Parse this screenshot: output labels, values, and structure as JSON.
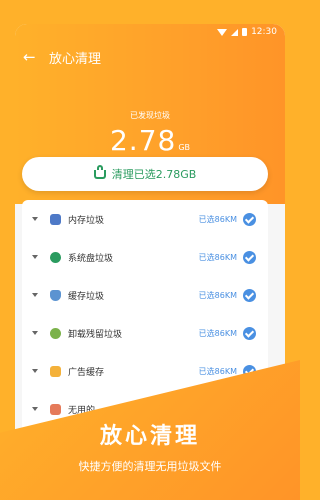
{
  "status": {
    "time": "12:30"
  },
  "header": {
    "back_icon": "arrow-left-icon",
    "title": "放心清理"
  },
  "summary": {
    "label": "已发现垃圾",
    "size": "2.78",
    "unit": "GB"
  },
  "action": {
    "label": "清理已选2.78GB",
    "icon": "basket-icon"
  },
  "items": [
    {
      "label": "内存垃圾",
      "selected": "已选86KM",
      "icon": "ram-icon"
    },
    {
      "label": "系统盘垃圾",
      "selected": "已选86KM",
      "icon": "disk-icon"
    },
    {
      "label": "缓存垃圾",
      "selected": "已选86KM",
      "icon": "cache-icon"
    },
    {
      "label": "卸载残留垃圾",
      "selected": "已选86KM",
      "icon": "uninstall-icon"
    },
    {
      "label": "广告缓存",
      "selected": "已选86KM",
      "icon": "ad-icon"
    },
    {
      "label": "无用的",
      "selected": "",
      "icon": "useless-file-icon"
    }
  ],
  "promo": {
    "title": "放心清理",
    "subtitle": "快捷方便的清理无用垃圾文件"
  },
  "colors": {
    "accent": "#ffa02a",
    "green": "#2a9b5f",
    "blue": "#4a90e2"
  }
}
